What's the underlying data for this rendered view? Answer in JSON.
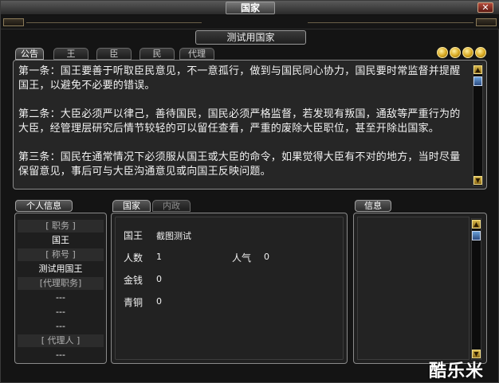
{
  "window": {
    "title": "国家",
    "close_label": "✕"
  },
  "nation_name": "测试用国家",
  "tabs_top": [
    {
      "label": "公告",
      "active": true
    },
    {
      "label": "王",
      "active": false
    },
    {
      "label": "臣",
      "active": false
    },
    {
      "label": "民",
      "active": false
    },
    {
      "label": "代理",
      "active": false
    }
  ],
  "coins": [
    "coin",
    "coin",
    "coin",
    "coin"
  ],
  "notice": {
    "paragraphs": [
      "第一条：国王要善于听取臣民意见，不一意孤行，做到与国民同心协力，国民要时常监督并提醒国王，以避免不必要的错误。",
      "第二条：大臣必须严以律己，善待国民，国民必须严格监督，若发现有叛国，通敌等严重行为的大臣，经管理层研究后情节较轻的可以留任查看，严重的废除大臣职位，甚至开除出国家。",
      "第三条：国民在通常情况下必须服从国王或大臣的命令，如果觉得大臣有不对的地方，当时尽量保留意见，事后可与大臣沟通意见或向国王反映问题。"
    ]
  },
  "personal": {
    "header": "个人信息",
    "rows": [
      {
        "type": "label",
        "text": "[ 职务 ]"
      },
      {
        "type": "val",
        "text": "国王"
      },
      {
        "type": "label",
        "text": "[ 称号 ]"
      },
      {
        "type": "val",
        "text": "测试用国王"
      },
      {
        "type": "label",
        "text": "[代理职务]"
      },
      {
        "type": "val",
        "text": "---"
      },
      {
        "type": "val",
        "text": "---"
      },
      {
        "type": "val",
        "text": "---"
      },
      {
        "type": "label",
        "text": "[ 代理人 ]"
      },
      {
        "type": "val",
        "text": "---"
      }
    ]
  },
  "nation_tabs": [
    {
      "label": "国家",
      "active": true
    },
    {
      "label": "内政",
      "active": false
    }
  ],
  "nation_info": {
    "king_label": "国王",
    "king_value": "截图测试",
    "population_label": "人数",
    "population_value": "1",
    "popularity_label": "人气",
    "popularity_value": "0",
    "money_label": "金钱",
    "money_value": "0",
    "bronze_label": "青铜",
    "bronze_value": "0"
  },
  "messages": {
    "header": "信息"
  },
  "watermark": "酷乐米"
}
